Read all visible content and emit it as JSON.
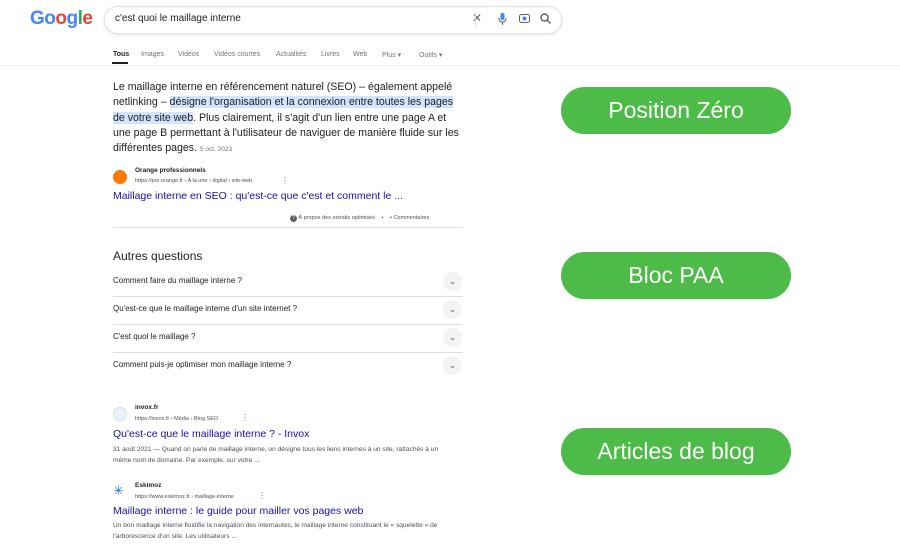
{
  "header": {
    "logo": "Google",
    "search_query": "c'est quoi le maillage interne"
  },
  "tabs": [
    "Tous",
    "Images",
    "Vidéos",
    "Vidéos courtes",
    "Actualités",
    "Livres",
    "Web",
    "Plus",
    "Outils"
  ],
  "snippet": {
    "text_before": "Le maillage interne en référencement naturel (SEO) – également appelé netlinking – ",
    "text_highlight": "désigne l'organisation et la connexion entre toutes les pages de votre site web",
    "text_after": ". Plus clairement, il s'agit d'un lien entre une page A et une page B permettant à l'utilisateur de naviguer de manière fluide sur les différentes pages.",
    "date": "5 oct. 2023",
    "source_name": "Orange professionnels",
    "source_url": "https://pro.orange.fr › A la une › digital › site-web",
    "link_title": "Maillage interne en SEO : qu'est-ce que c'est et comment le ...",
    "about": "À propos des extraits optimisés",
    "comments": "Commentaires"
  },
  "paa": {
    "title": "Autres questions",
    "questions": [
      "Comment faire du maillage interne ?",
      "Qu'est-ce que le maillage interne d'un site internet ?",
      "C'est quoi le maillage ?",
      "Comment puis-je optimiser mon maillage interne ?"
    ]
  },
  "results": [
    {
      "site": "invox.fr",
      "url": "https://invox.fr › Média › Blog SEO",
      "title": "Qu'est-ce que le maillage interne ? - Invox",
      "desc": "31 août 2021 — Quand on parle de maillage interne, on désigne tous les liens internes à un site, rattachés à un même nom de domaine. Par exemple, sur votre ..."
    },
    {
      "site": "Eskimoz",
      "url": "https://www.eskimoz.fr › maillage-interne",
      "title": "Maillage interne : le guide pour mailler vos pages web",
      "desc": "Un bon maillage interne fluidifie la navigation des internautes, le maillage interne constituant le « squelette » de l'arborescence d'un site. Les utilisateurs ..."
    }
  ],
  "labels": [
    "Position Zéro",
    "Bloc PAA",
    "Articles de blog"
  ],
  "colors": {
    "pill": "#4cbb47",
    "link": "#1a0dab",
    "highlight": "#d2e3fc"
  }
}
